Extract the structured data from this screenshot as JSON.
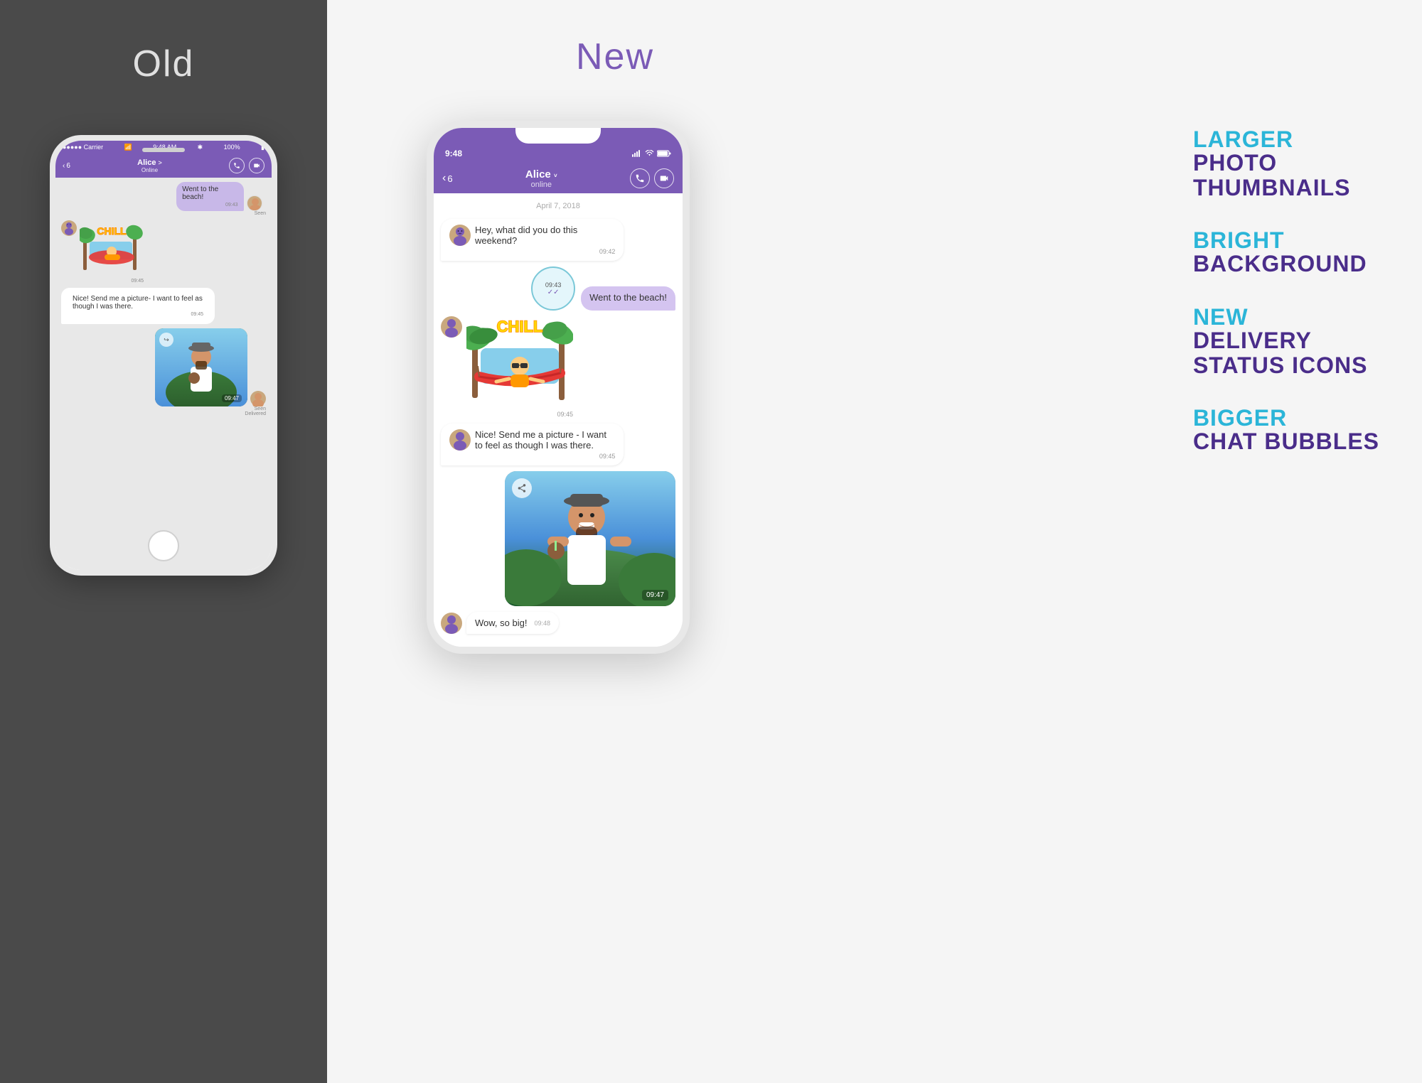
{
  "left": {
    "section_title": "Old",
    "phone": {
      "status_bar": {
        "carrier": "●●●●● Carrier",
        "wifi": "WiFi",
        "time": "9:48 AM",
        "bluetooth": "BT",
        "battery": "100%"
      },
      "nav": {
        "back_label": "6",
        "contact_name": "Alice",
        "contact_chevron": ">",
        "contact_status": "Online"
      },
      "messages": [
        {
          "type": "sent",
          "text": "Went to the beach!",
          "time": "09:43",
          "seen": "Seen"
        },
        {
          "type": "sticker",
          "time": "09:45"
        },
        {
          "type": "received",
          "text": "Nice! Send me a picture- I want to feel as though I was there.",
          "time": "09:45"
        },
        {
          "type": "photo",
          "time": "09:47",
          "seen": "Seen",
          "delivered": "Delivered"
        }
      ]
    }
  },
  "right": {
    "section_title": "New",
    "phone": {
      "status_bar": {
        "time": "9:48",
        "signal": "Signal",
        "wifi": "WiFi",
        "battery": "Battery"
      },
      "nav": {
        "back_label": "6",
        "contact_name": "Alice",
        "contact_status": "online"
      },
      "date_divider": "April 7, 2018",
      "messages": [
        {
          "type": "received",
          "text": "Hey, what did you do this weekend?",
          "time": "09:42"
        },
        {
          "type": "sent",
          "text": "Went to the beach!",
          "time": "09:43",
          "ticks": "✓✓"
        },
        {
          "type": "sticker",
          "time": "09:45"
        },
        {
          "type": "received",
          "text": "Nice! Send me a picture - I want to feel as though I was there.",
          "time": "09:45"
        },
        {
          "type": "photo",
          "time": "09:47"
        },
        {
          "type": "wow",
          "text": "Wow, so big!",
          "time": "09:48"
        }
      ]
    },
    "features": [
      {
        "highlight": "LARGER",
        "main": "PHOTO\nTHUMBNAILS"
      },
      {
        "highlight": "BRIGHT",
        "main": "BACKGROUND"
      },
      {
        "highlight": "NEW",
        "main": "DELIVERY\nSTATUS ICONS"
      },
      {
        "highlight": "BIGGER",
        "main": "CHAT BUBBLES"
      }
    ]
  }
}
